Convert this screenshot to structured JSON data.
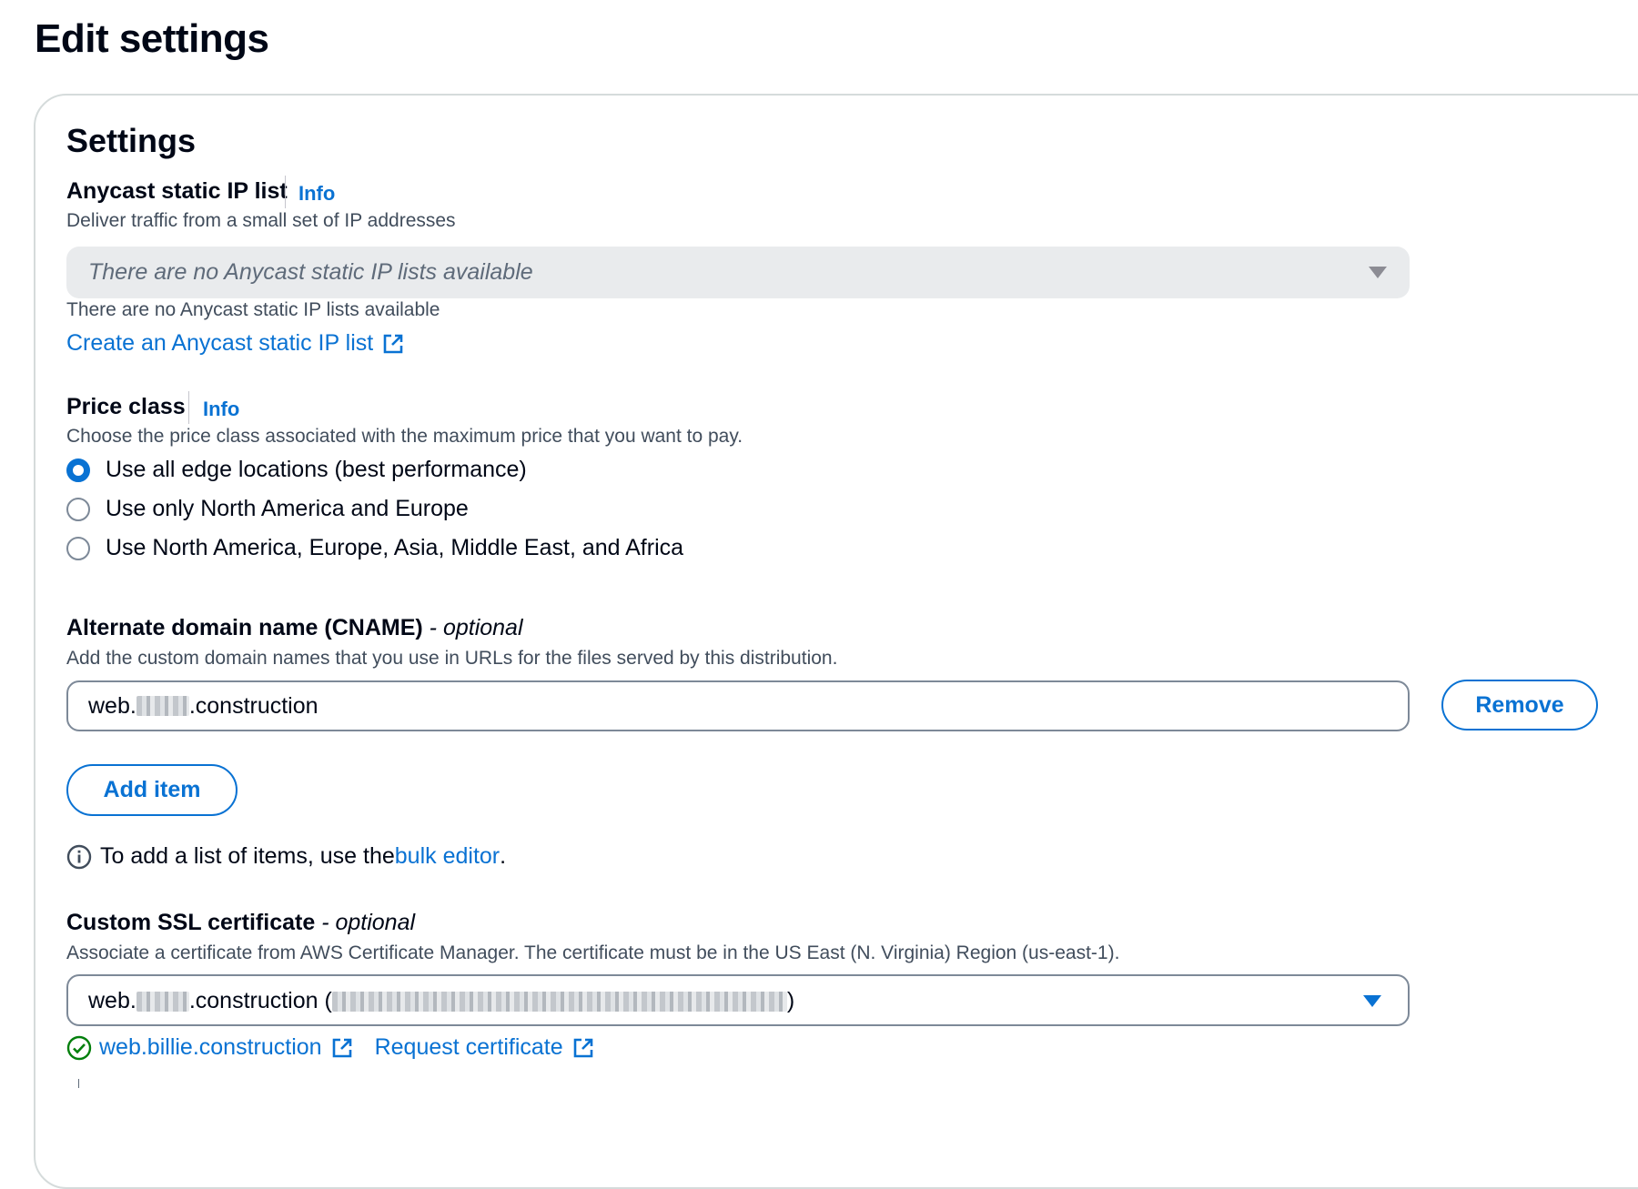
{
  "page": {
    "title": "Edit settings"
  },
  "panel": {
    "title": "Settings"
  },
  "anycast": {
    "label": "Anycast static IP list",
    "info": "Info",
    "description": "Deliver traffic from a small set of IP addresses",
    "select_placeholder": "There are no Anycast static IP lists available",
    "hint": "There are no Anycast static IP lists available",
    "create_link": "Create an Anycast static IP list"
  },
  "price_class": {
    "label": "Price class",
    "info": "Info",
    "description": "Choose the price class associated with the maximum price that you want to pay.",
    "options": [
      {
        "label": "Use all edge locations (best performance)",
        "checked": true
      },
      {
        "label": "Use only North America and Europe",
        "checked": false
      },
      {
        "label": "Use North America, Europe, Asia, Middle East, and Africa",
        "checked": false
      }
    ]
  },
  "cname": {
    "label": "Alternate domain name (CNAME)",
    "optional": "- optional",
    "description": "Add the custom domain names that you use in URLs for the files served by this distribution.",
    "value_prefix": "web.",
    "value_suffix": ".construction",
    "remove_button": "Remove",
    "add_button": "Add item",
    "note_text": "To add a list of items, use the ",
    "note_link": "bulk editor",
    "note_end": "."
  },
  "ssl": {
    "label": "Custom SSL certificate",
    "optional": "- optional",
    "description": "Associate a certificate from AWS Certificate Manager. The certificate must be in the US East (N. Virginia) Region (us-east-1).",
    "value_prefix": "web.",
    "value_middle": ".construction (",
    "value_end": ")",
    "cert_link": "web.billie.construction",
    "request_link": "Request certificate"
  },
  "colors": {
    "accent": "#0972d3",
    "success": "#037f0c",
    "text": "#000716",
    "muted": "#414d5c"
  }
}
